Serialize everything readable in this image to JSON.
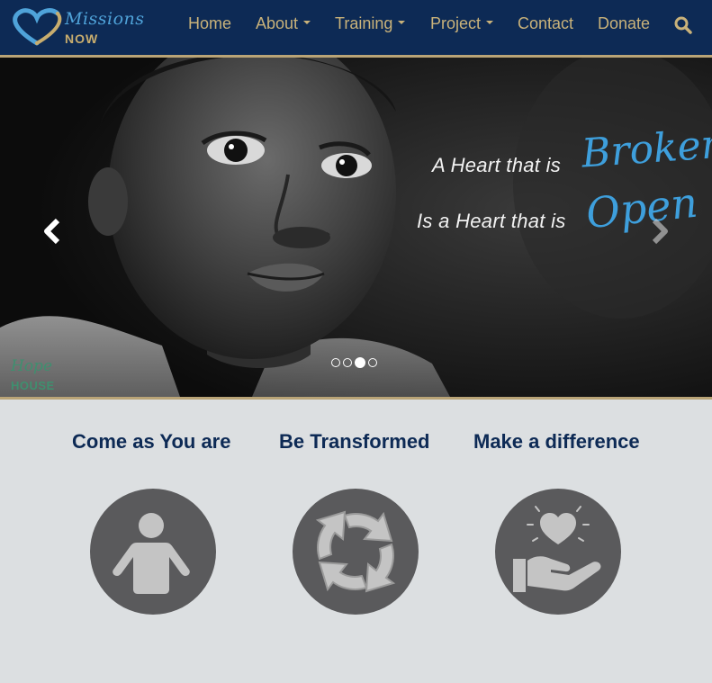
{
  "brand": {
    "script_text": "Missions",
    "word_text": "NOW"
  },
  "nav": {
    "items": [
      {
        "label": "Home",
        "dropdown": false
      },
      {
        "label": "About",
        "dropdown": true
      },
      {
        "label": "Training",
        "dropdown": true
      },
      {
        "label": "Project",
        "dropdown": true
      },
      {
        "label": "Contact",
        "dropdown": false
      },
      {
        "label": "Donate",
        "dropdown": false
      }
    ],
    "search_icon": "search-icon"
  },
  "hero": {
    "line1": "A Heart that is",
    "word1": "Broken",
    "line2": "Is a Heart that is",
    "word2": "Open",
    "watermark_script": "Hope",
    "watermark_word": "HOUSE",
    "slide_count": 4,
    "active_slide": 3
  },
  "features": [
    {
      "title": "Come as You are",
      "icon": "person-icon"
    },
    {
      "title": "Be Transformed",
      "icon": "cycle-arrows-icon"
    },
    {
      "title": "Make a difference",
      "icon": "heart-hand-icon"
    }
  ],
  "colors": {
    "navbar": "#0d2a55",
    "nav_text": "#c9b27a",
    "accent_gold": "#b9a477",
    "hero_script_blue": "#3e9fdc",
    "page_bg": "#dcdfe1",
    "heading_navy": "#0d2a55",
    "icon_circle": "#5a5a5c",
    "icon_glyph": "#c4c4c4"
  }
}
